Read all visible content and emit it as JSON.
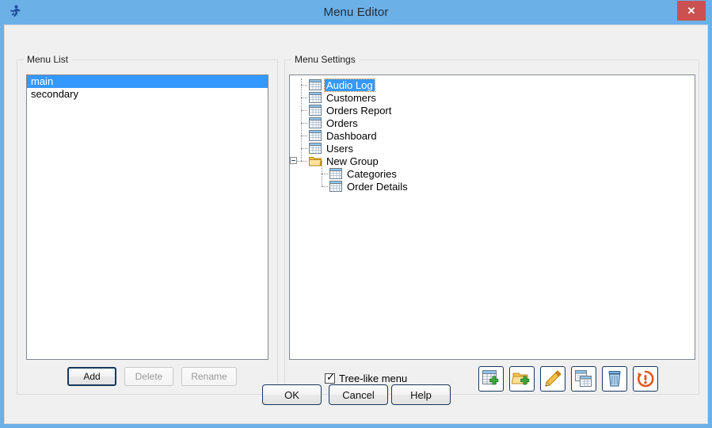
{
  "window": {
    "title": "Menu Editor",
    "app_icon": "runner-icon",
    "close_label": "✕",
    "titlebar_color": "#6cb0e8",
    "close_button_color": "#cb5050",
    "client_background": "#f0f0f0"
  },
  "menu_list_group": {
    "label": "Menu List",
    "items": [
      {
        "label": "main",
        "selected": true
      },
      {
        "label": "secondary",
        "selected": false
      }
    ],
    "buttons": [
      {
        "label": "Add",
        "enabled": true,
        "default": true
      },
      {
        "label": "Delete",
        "enabled": false,
        "default": false
      },
      {
        "label": "Rename",
        "enabled": false,
        "default": false
      }
    ]
  },
  "menu_settings_group": {
    "label": "Menu Settings",
    "tree": [
      {
        "label": "Audio Log",
        "icon": "table-icon",
        "level": 0,
        "selected": true,
        "expander": false
      },
      {
        "label": "Customers",
        "icon": "table-icon",
        "level": 0,
        "selected": false,
        "expander": false
      },
      {
        "label": "Orders Report",
        "icon": "table-icon",
        "level": 0,
        "selected": false,
        "expander": false
      },
      {
        "label": "Orders",
        "icon": "table-icon",
        "level": 0,
        "selected": false,
        "expander": false
      },
      {
        "label": "Dashboard",
        "icon": "table-icon",
        "level": 0,
        "selected": false,
        "expander": false
      },
      {
        "label": "Users",
        "icon": "table-icon",
        "level": 0,
        "selected": false,
        "expander": false
      },
      {
        "label": "New Group",
        "icon": "folder-icon",
        "level": 0,
        "selected": false,
        "expander": true
      },
      {
        "label": "Categories",
        "icon": "table-icon",
        "level": 1,
        "selected": false,
        "expander": false
      },
      {
        "label": "Order Details",
        "icon": "table-icon",
        "level": 1,
        "selected": false,
        "expander": false
      }
    ],
    "selection_color": "#3399ff",
    "tree_like_checkbox": {
      "label": "Tree-like  menu",
      "checked": true
    },
    "toolbar": [
      {
        "name": "add-table-button",
        "icon": "table-add-icon"
      },
      {
        "name": "add-folder-button",
        "icon": "folder-add-icon"
      },
      {
        "name": "edit-button",
        "icon": "pencil-icon"
      },
      {
        "name": "duplicate-button",
        "icon": "copy-windows-icon"
      },
      {
        "name": "delete-button",
        "icon": "trash-icon"
      },
      {
        "name": "reset-button",
        "icon": "refresh-warning-icon"
      }
    ]
  },
  "dialog_buttons": [
    {
      "label": "OK"
    },
    {
      "label": "Cancel"
    },
    {
      "label": "Help"
    }
  ]
}
